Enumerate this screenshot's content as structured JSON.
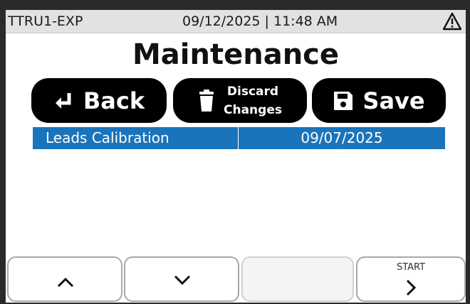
{
  "status": {
    "device": "TTRU1-EXP",
    "datetime": "09/12/2025 | 11:48 AM",
    "warning_icon": "warning-triangle-icon"
  },
  "page": {
    "title": "Maintenance"
  },
  "actions": {
    "back_label": "Back",
    "discard_line1": "Discard",
    "discard_line2": "Changes",
    "save_label": "Save",
    "back_icon": "return-arrow-icon",
    "discard_icon": "trash-icon",
    "save_icon": "floppy-disk-icon"
  },
  "list": {
    "rows": [
      {
        "name": "Leads Calibration",
        "date": "09/07/2025"
      }
    ],
    "selected_color": "#1a74bb"
  },
  "nav": {
    "start_label": "START",
    "up_icon": "chevron-up-icon",
    "down_icon": "chevron-down-icon",
    "next_icon": "chevron-right-icon"
  }
}
